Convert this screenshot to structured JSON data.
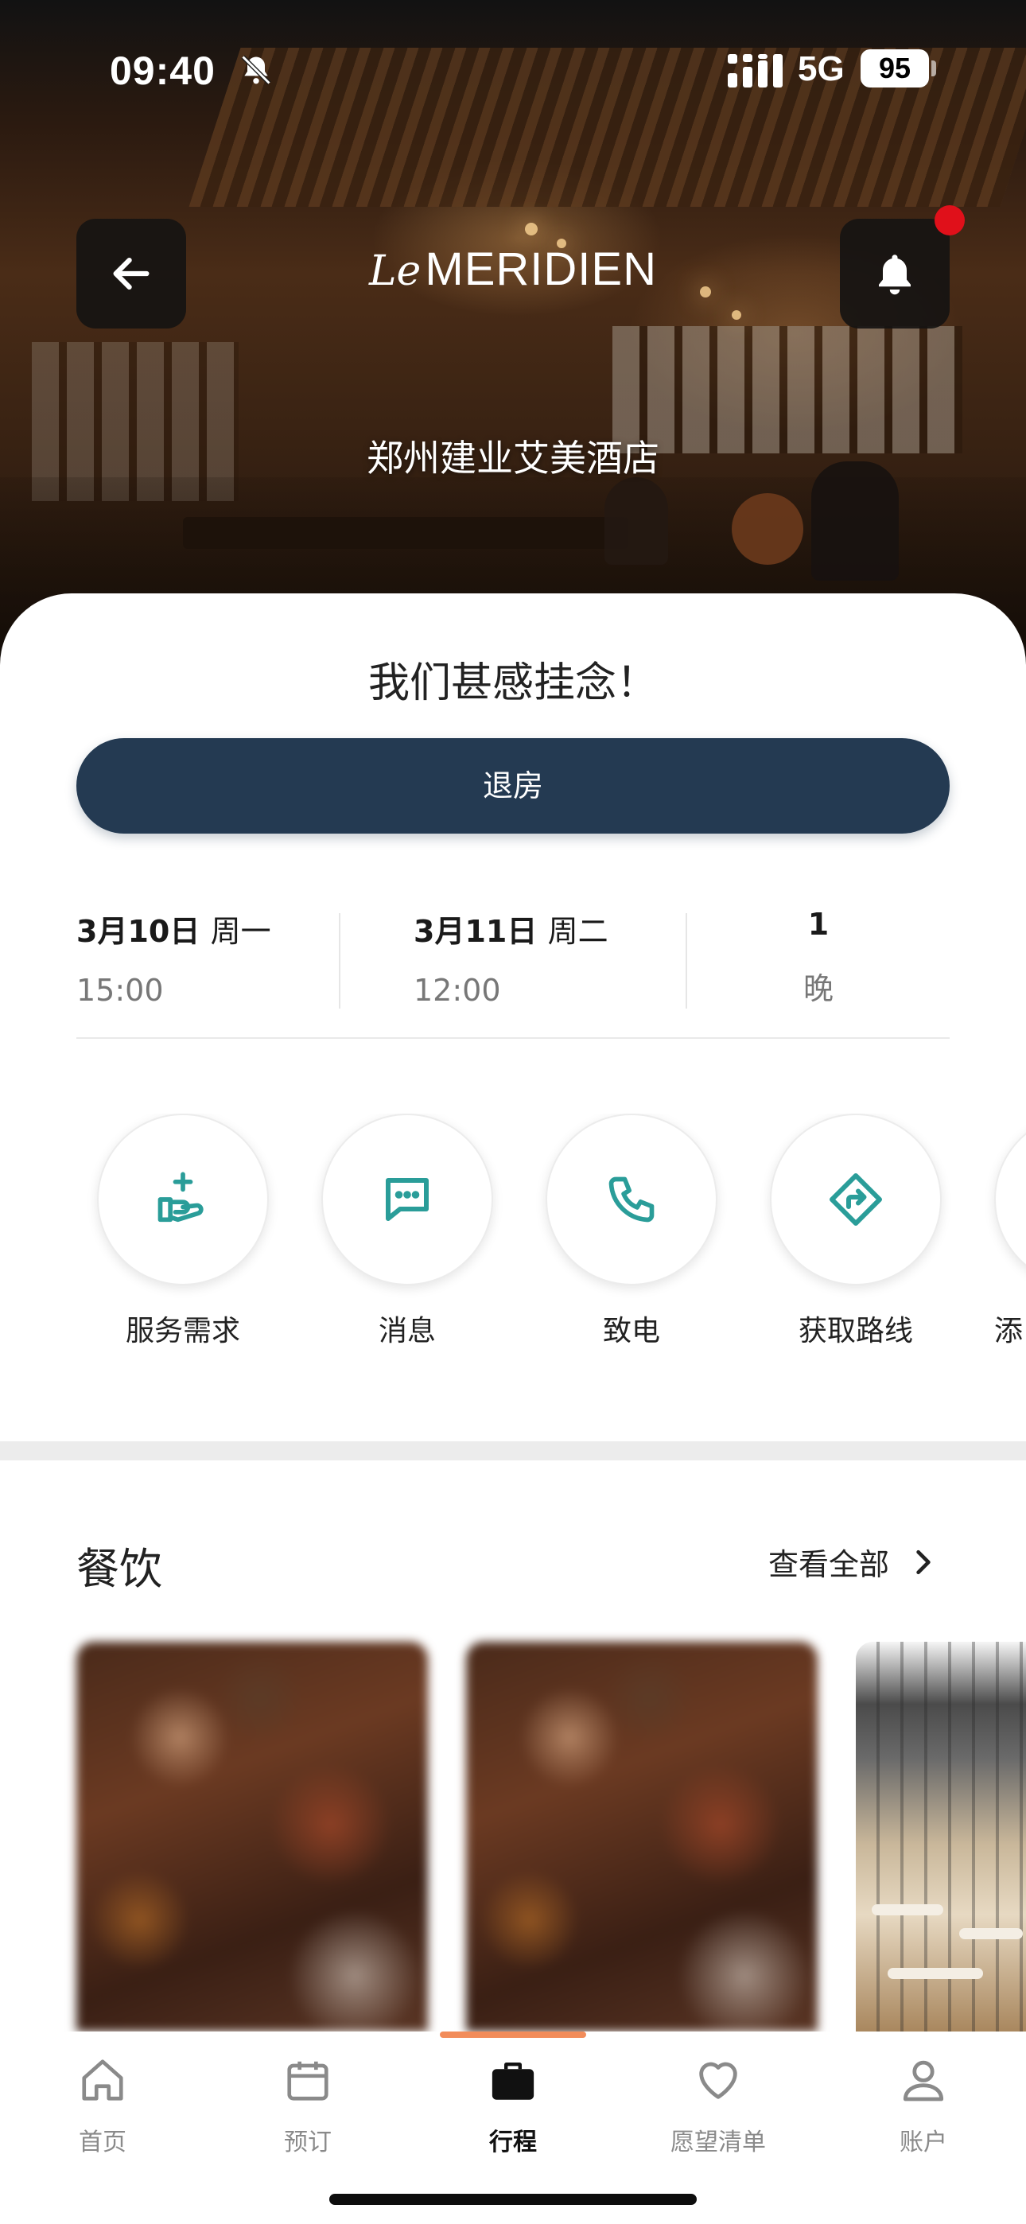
{
  "status_bar": {
    "time": "09:40",
    "network": "5G",
    "battery": "95",
    "icons": [
      "bell-slash-icon",
      "signal-icon"
    ]
  },
  "header": {
    "brand_le": "Le",
    "brand_name": "MERIDIEN",
    "hotel_name": "郑州建业艾美酒店",
    "back_icon": "arrow-left-icon",
    "notification_icon": "bell-icon",
    "notification_dot_color": "#e0101a"
  },
  "stay": {
    "greeting": "我们甚感挂念！",
    "checkout_label": "退房",
    "checkin": {
      "date": "3月10日",
      "weekday": "周一",
      "time": "15:00"
    },
    "checkout": {
      "date": "3月11日",
      "weekday": "周二",
      "time": "12:00"
    },
    "nights": {
      "count": "1",
      "unit": "晚"
    }
  },
  "quick_actions": [
    {
      "label": "服务需求",
      "icon": "service-request-icon"
    },
    {
      "label": "消息",
      "icon": "message-icon"
    },
    {
      "label": "致电",
      "icon": "phone-icon"
    },
    {
      "label": "获取路线",
      "icon": "directions-icon"
    },
    {
      "label": "添",
      "icon": "add-icon"
    }
  ],
  "dining": {
    "title": "餐饮",
    "view_all": "查看全部"
  },
  "tabbar": {
    "tabs": [
      {
        "label": "首页",
        "icon": "home-icon",
        "active": false
      },
      {
        "label": "预订",
        "icon": "calendar-icon",
        "active": false
      },
      {
        "label": "行程",
        "icon": "briefcase-icon",
        "active": true
      },
      {
        "label": "愿望清单",
        "icon": "heart-icon",
        "active": false
      },
      {
        "label": "账户",
        "icon": "person-icon",
        "active": false
      }
    ]
  },
  "colors": {
    "primary_button": "#243a52",
    "accent_teal": "#2a9d99",
    "tab_indicator": "#f28c5a"
  }
}
